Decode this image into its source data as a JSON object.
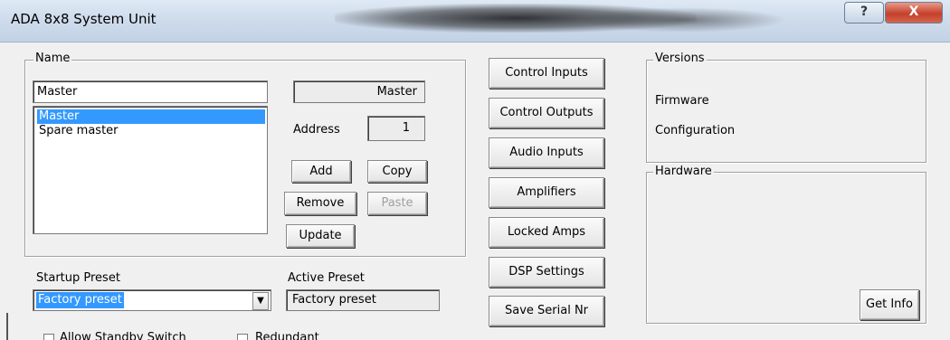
{
  "window": {
    "title": "ADA 8x8 System Unit",
    "help_label": "?",
    "close_label": "X"
  },
  "name_group": {
    "label": "Name",
    "name_input_value": "Master",
    "list_items": [
      "Master",
      "Spare master"
    ],
    "selected_index": 0,
    "display_name": "Master",
    "address_label": "Address",
    "address_value": "1",
    "add_label": "Add",
    "copy_label": "Copy",
    "remove_label": "Remove",
    "paste_label": "Paste",
    "update_label": "Update"
  },
  "presets": {
    "startup_label": "Startup Preset",
    "startup_value": "Factory preset",
    "active_label": "Active Preset",
    "active_value": "Factory preset",
    "dropdown_arrow": "▼"
  },
  "center_buttons": {
    "control_inputs": "Control Inputs",
    "control_outputs": "Control Outputs",
    "audio_inputs": "Audio Inputs",
    "amplifiers": "Amplifiers",
    "locked_amps": "Locked Amps",
    "dsp_settings": "DSP Settings",
    "save_serial": "Save Serial Nr"
  },
  "versions": {
    "label": "Versions",
    "firmware_label": "Firmware",
    "configuration_label": "Configuration"
  },
  "hardware": {
    "label": "Hardware",
    "get_info_label": "Get Info"
  },
  "bottom": {
    "allow_standby_label": "Allow Standby Switch",
    "redundant_label": "Redundant"
  },
  "colors": {
    "selection": "#3399ff",
    "close_button": "#c4402a",
    "titlebar": "#cfdcec"
  }
}
